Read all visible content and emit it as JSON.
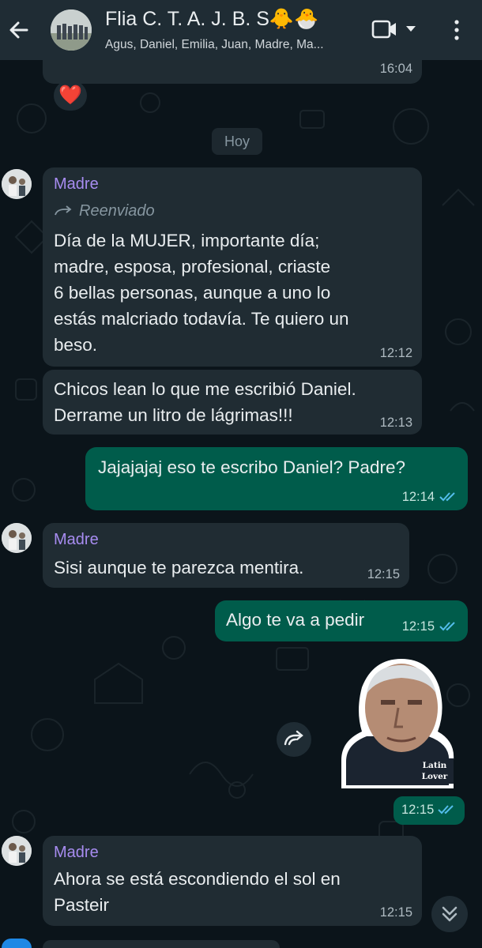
{
  "header": {
    "title": "Flia C. T. A. J. B. S🐥🐣",
    "members": "Agus, Daniel, Emilia, Juan, Madre, Ma..."
  },
  "top_partial": {
    "time": "16:04",
    "reaction": "❤️"
  },
  "date_divider": "Hoy",
  "messages": [
    {
      "sender": "Madre",
      "forwarded_label": "Reenviado",
      "lines": [
        "Día de la MUJER, importante día;",
        "madre, esposa, profesional, criaste",
        "6 bellas personas, aunque a uno lo",
        "estás malcriado todavía. Te quiero un",
        "beso."
      ],
      "time": "12:12"
    },
    {
      "lines": [
        "Chicos lean lo que me escribió Daniel.",
        "Derrame un litro de lágrimas!!!"
      ],
      "time": "12:13"
    },
    {
      "text": "Jajajajaj eso te escribo Daniel? Padre?",
      "time": "12:14"
    },
    {
      "sender": "Madre",
      "text": "Sisi aunque te parezca mentira.",
      "time": "12:15"
    },
    {
      "text": "Algo te va a pedir",
      "time": "12:15"
    },
    {
      "sticker_caption": "Latin Lover",
      "time": "12:15"
    },
    {
      "sender": "Madre",
      "lines": [
        "Ahora se está escondiendo el sol en",
        "Pasteir"
      ],
      "time": "12:15"
    }
  ],
  "icons": {
    "back": "arrow-left-icon",
    "video": "video-camera-icon",
    "menu": "more-vertical-icon",
    "forward": "forward-icon",
    "scroll": "double-chevron-down-icon"
  },
  "colors": {
    "incoming": "#202c33",
    "outgoing": "#005c4b",
    "sender": "#a78cf0",
    "read_ticks": "#53bdeb"
  }
}
